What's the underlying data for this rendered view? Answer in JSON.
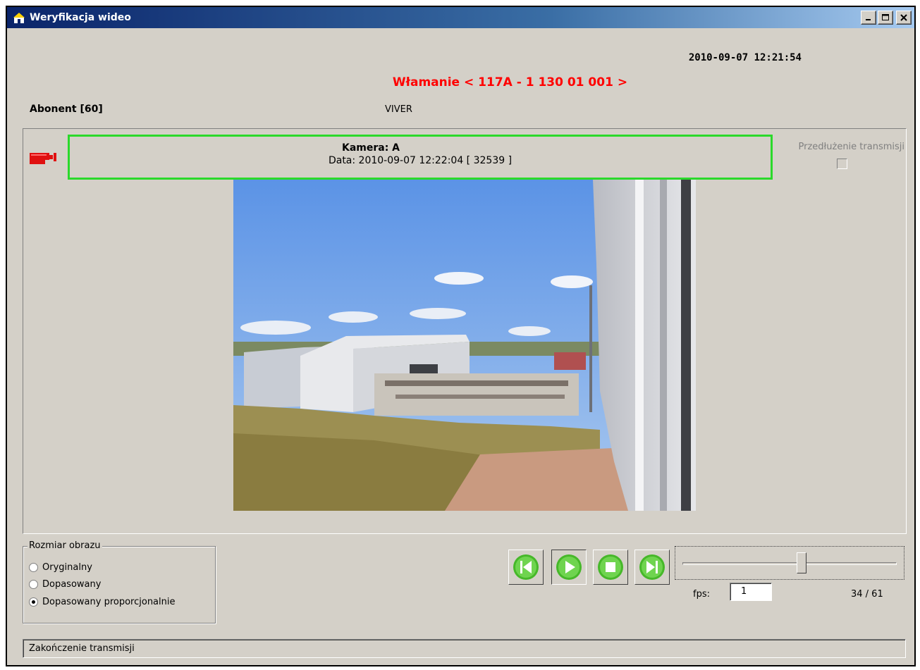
{
  "window": {
    "title": "Weryfikacja wideo",
    "minimize_label": "_",
    "maximize_label": "□",
    "close_label": "×"
  },
  "header": {
    "datetime": "2010-09-07 12:21:54",
    "alarm": "Włamanie < 117A - 1 130 01 001 >",
    "subscriber_label": "Abonent [60]",
    "subscriber_name": "VIVER"
  },
  "camera": {
    "name": "Kamera: A",
    "date": "Data: 2010-09-07 12:22:04 [ 32539 ]",
    "extend_label": "Przedłużenie transmisji",
    "extend_checked": false
  },
  "image_size": {
    "legend": "Rozmiar obrazu",
    "options": [
      {
        "label": "Oryginalny",
        "checked": false
      },
      {
        "label": "Dopasowany",
        "checked": false
      },
      {
        "label": "Dopasowany proporcjonalnie",
        "checked": true
      }
    ]
  },
  "player": {
    "buttons": [
      "previous-frame",
      "play",
      "stop",
      "next-frame"
    ],
    "slider_value": 34,
    "slider_max": 61,
    "fps_label": "fps:",
    "fps_value": "1",
    "frame_counter": "34 / 61"
  },
  "status": {
    "text": "Zakończenie transmisji"
  },
  "colors": {
    "alarm": "#ff0000",
    "banner_border": "#2bd92b",
    "button_green": "#46b829",
    "title_gradient_start": "#0a246a"
  }
}
